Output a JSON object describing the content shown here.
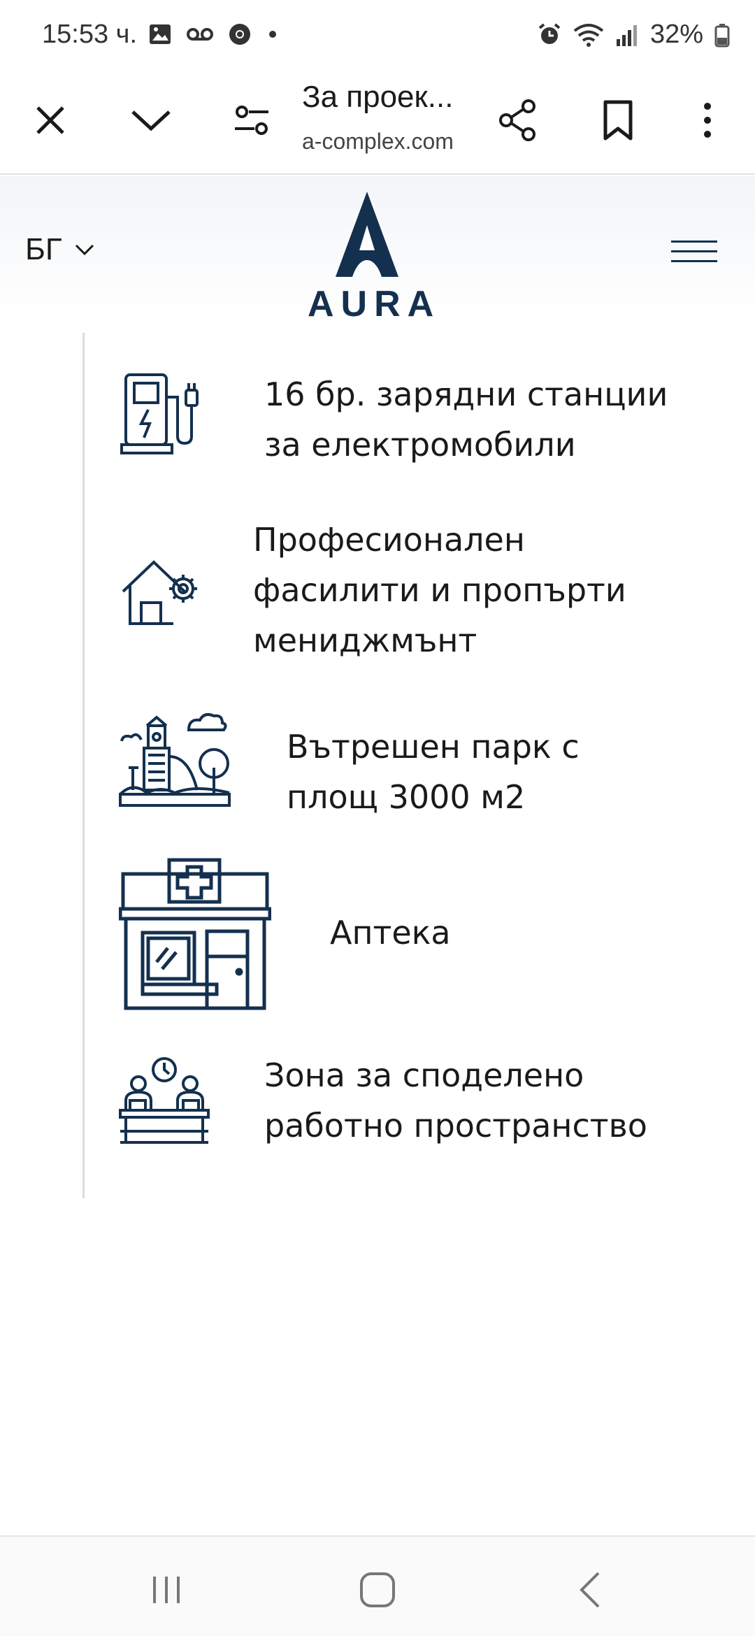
{
  "status_bar": {
    "time": "15:53 ч.",
    "battery": "32%"
  },
  "toolbar": {
    "page_title": "За проек...",
    "url": "a-complex.com"
  },
  "site_header": {
    "language": "БГ",
    "logo_text": "AURA"
  },
  "features": [
    {
      "icon": "ev-charger-icon",
      "lines": [
        "16 бр. зарядни станции",
        "за електромобили"
      ]
    },
    {
      "icon": "house-gear-icon",
      "lines": [
        "Професионален",
        "фасилити и пропърти",
        "мениджмънт"
      ]
    },
    {
      "icon": "park-playground-icon",
      "lines": [
        "Вътрешен парк с",
        "площ 3000 м2"
      ]
    },
    {
      "icon": "pharmacy-icon",
      "lines": [
        "Аптека"
      ]
    },
    {
      "icon": "coworking-icon",
      "lines": [
        "Зона за споделено",
        "работно пространство"
      ]
    }
  ],
  "colors": {
    "brand_navy": "#14304f"
  }
}
